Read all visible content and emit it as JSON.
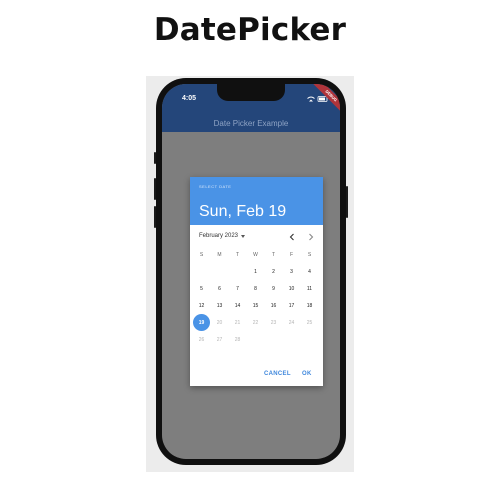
{
  "header": {
    "title": "DatePicker"
  },
  "status_bar": {
    "time": "4:05",
    "debug_banner": "DEBUG"
  },
  "app": {
    "title": "Date Picker Example"
  },
  "date_picker": {
    "help_text": "SELECT DATE",
    "selected_date_text": "Sun, Feb 19",
    "month_label": "February 2023",
    "weekdays": [
      "S",
      "M",
      "T",
      "W",
      "T",
      "F",
      "S"
    ],
    "selected_day": 19,
    "cancel_label": "CANCEL",
    "ok_label": "OK",
    "accent_color": "#4a93e6",
    "weeks": [
      [
        "",
        "",
        "",
        "1",
        "2",
        "3",
        "4"
      ],
      [
        "5",
        "6",
        "7",
        "8",
        "9",
        "10",
        "11"
      ],
      [
        "12",
        "13",
        "14",
        "15",
        "16",
        "17",
        "18"
      ],
      [
        "19",
        "20",
        "21",
        "22",
        "23",
        "24",
        "25"
      ],
      [
        "26",
        "27",
        "28",
        "",
        "",
        "",
        ""
      ]
    ]
  },
  "icons": {
    "dropdown": "chevron-down-icon",
    "prev": "chevron-left-icon",
    "next": "chevron-right-icon",
    "wifi": "wifi-icon",
    "battery": "battery-icon"
  }
}
